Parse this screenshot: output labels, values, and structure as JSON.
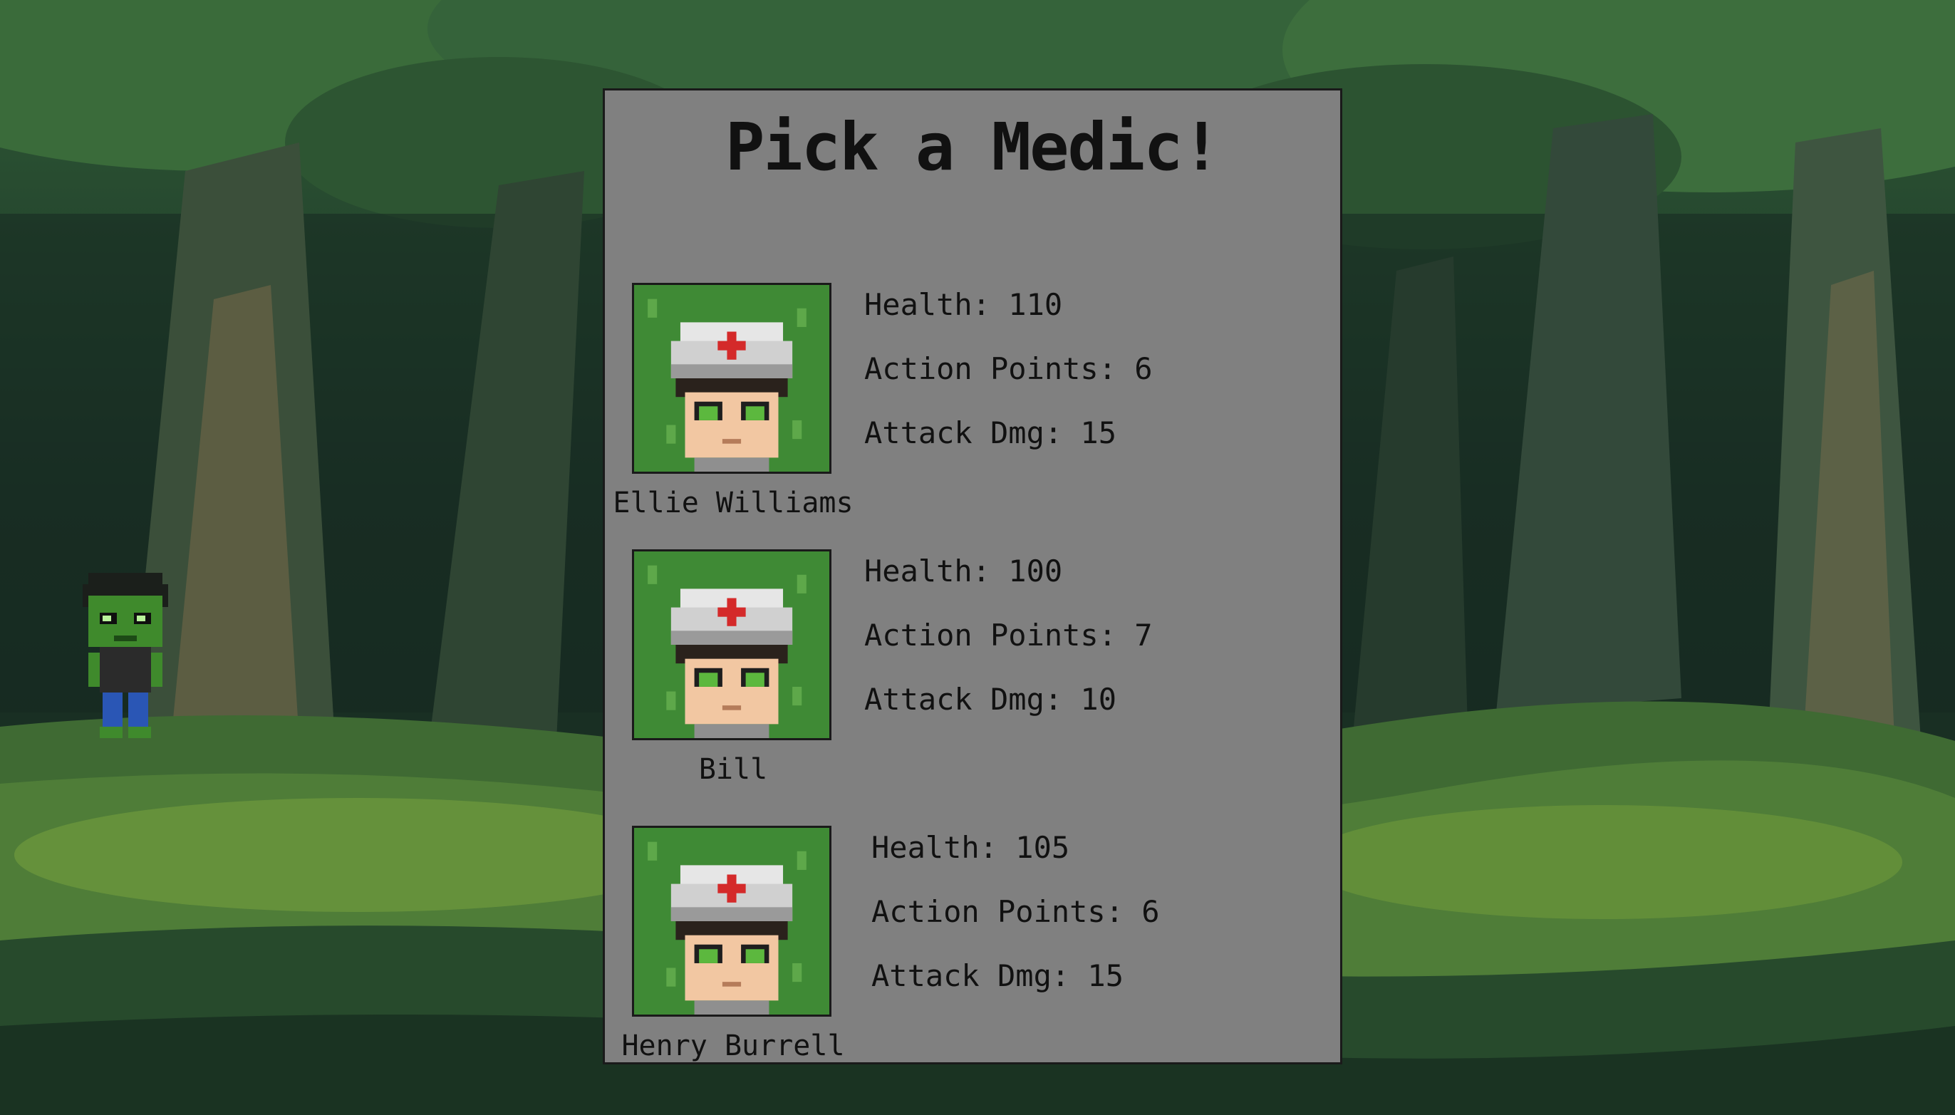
{
  "panel": {
    "title": "Pick a Medic!"
  },
  "medics": [
    {
      "name": "Ellie Williams",
      "health": "Health: 110",
      "action_points": "Action Points: 6",
      "attack_dmg": "Attack Dmg: 15"
    },
    {
      "name": "Bill",
      "health": "Health: 100",
      "action_points": "Action Points: 7",
      "attack_dmg": "Attack Dmg: 10"
    },
    {
      "name": "Henry Burrell",
      "health": "Health: 105",
      "action_points": "Action Points: 6",
      "attack_dmg": "Attack Dmg: 15"
    }
  ],
  "icons": {
    "player": "zombie-player-sprite-icon",
    "portrait": "medic-portrait-icon"
  },
  "colors": {
    "panel_bg": "#808080",
    "portrait_bg": "#3f8a35",
    "text": "#111111"
  }
}
